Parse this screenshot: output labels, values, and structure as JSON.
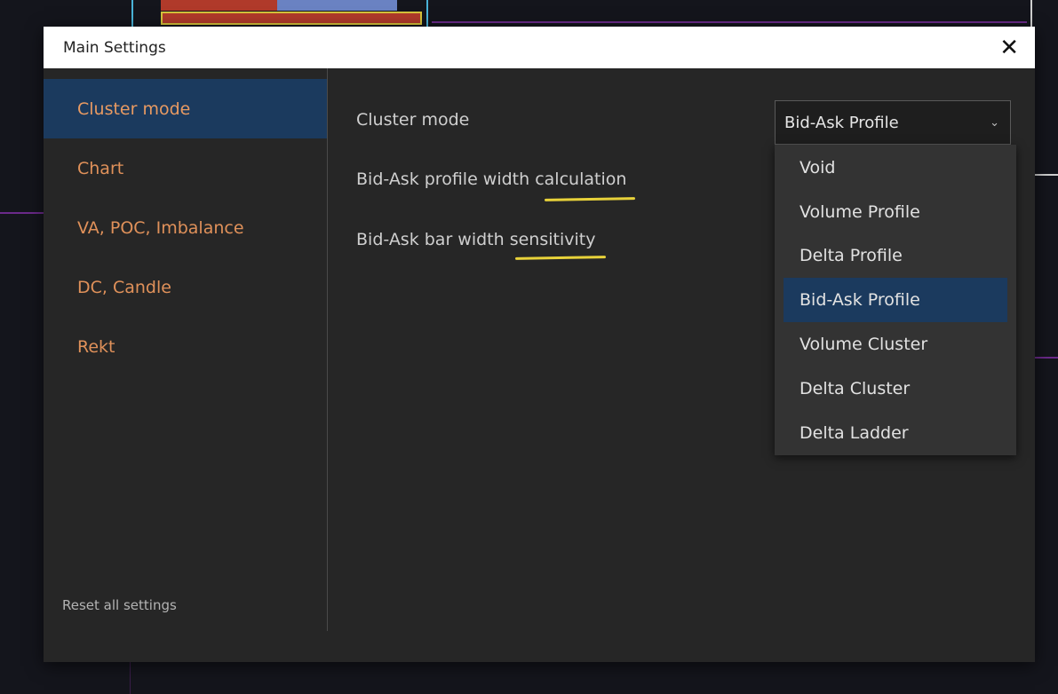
{
  "dialog": {
    "title": "Main Settings",
    "close_glyph": "✕"
  },
  "sidebar": {
    "items": [
      {
        "label": "Cluster mode",
        "active": true
      },
      {
        "label": "Chart"
      },
      {
        "label": "VA, POC, Imbalance"
      },
      {
        "label": "DC, Candle"
      },
      {
        "label": "Rekt"
      }
    ],
    "reset_label": "Reset all settings"
  },
  "settings": {
    "rows": [
      {
        "label": "Cluster mode"
      },
      {
        "label": "Bid-Ask profile width calculation"
      },
      {
        "label": "Bid-Ask bar width sensitivity"
      }
    ],
    "cluster_mode_select": {
      "value": "Bid-Ask Profile",
      "chevron": "⌄",
      "options": [
        "Void",
        "Volume Profile",
        "Delta Profile",
        "Bid-Ask Profile",
        "Volume Cluster",
        "Delta Cluster",
        "Delta Ladder"
      ],
      "selected_index": 3
    }
  },
  "colors": {
    "accent_orange": "#e0915a",
    "selection_blue": "#1b3a5e",
    "annotation_yellow": "#e8d23a"
  }
}
